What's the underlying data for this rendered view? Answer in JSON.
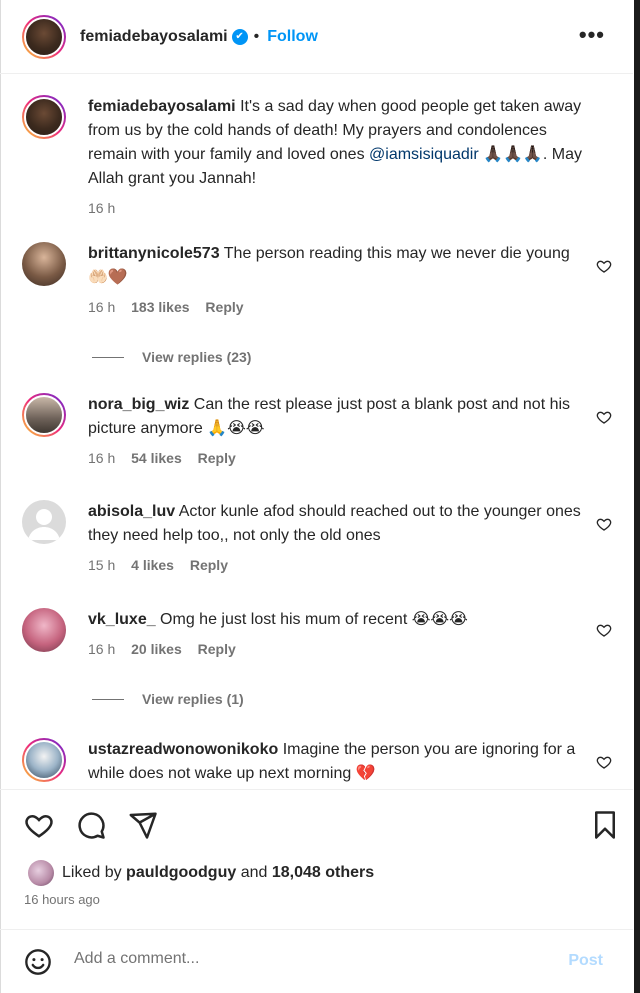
{
  "header": {
    "username": "femiadebayosalami",
    "separator": "•",
    "follow_label": "Follow",
    "more_label": "•••"
  },
  "caption": {
    "username": "femiadebayosalami",
    "text_before": " It's a sad day when good people get taken away from us by the cold hands of death! My prayers and condolences remain with your family and loved ones ",
    "mention": "@iamsisiquadir",
    "text_after": " 🙏🏿🙏🏿🙏🏿. May Allah grant you Jannah!",
    "time": "16 h"
  },
  "comments": [
    {
      "username": "brittanynicole573",
      "text": " The person reading this may we never die young 🤲🏻🤎",
      "time": "16 h",
      "likes": "183 likes",
      "reply": "Reply",
      "view_replies": "View replies (23)"
    },
    {
      "username": "nora_big_wiz",
      "text": " Can the rest please just post a blank post and not his picture anymore 🙏😭😭",
      "time": "16 h",
      "likes": "54 likes",
      "reply": "Reply"
    },
    {
      "username": "abisola_luv",
      "text": " Actor kunle afod should reached out to the younger ones they need help too,, not only the old ones",
      "time": "15 h",
      "likes": "4 likes",
      "reply": "Reply"
    },
    {
      "username": "vk_luxe_",
      "text": " Omg he just lost his mum of recent 😭😭😭",
      "time": "16 h",
      "likes": "20 likes",
      "reply": "Reply",
      "view_replies": "View replies (1)"
    },
    {
      "username": "ustazreadwonowonikoko",
      "text": " Imagine the person you are ignoring for a while does not wake up next morning 💔"
    }
  ],
  "footer": {
    "liked_by_prefix": "Liked by ",
    "liked_by_user": "pauldgoodguy",
    "liked_by_mid": " and ",
    "liked_by_others": "18,048 others",
    "time_ago": "16 hours ago",
    "comment_placeholder": "Add a comment...",
    "post_label": "Post"
  },
  "colors": {
    "accent": "#0095f6",
    "mention": "#00376b",
    "muted": "#737373",
    "post_disabled": "#b3dbff"
  },
  "icons": [
    "more-options-icon",
    "verified-badge-icon",
    "heart-icon",
    "comment-icon",
    "share-icon",
    "bookmark-icon",
    "emoji-icon"
  ]
}
